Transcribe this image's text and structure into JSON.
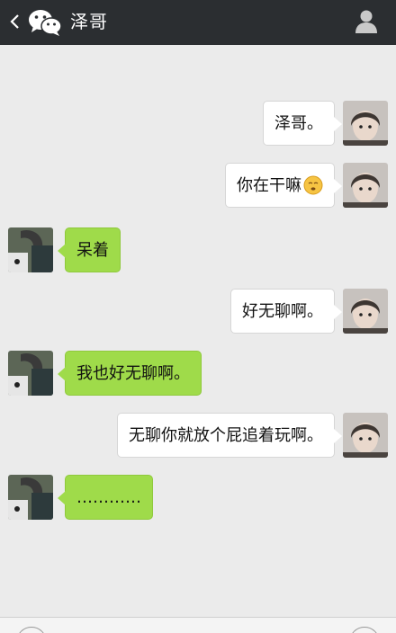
{
  "header": {
    "title": "泽哥",
    "back_icon": "back-chevron-icon",
    "app_icon": "wechat-icon",
    "profile_icon": "person-icon"
  },
  "messages": [
    {
      "side": "right",
      "text": "泽哥。"
    },
    {
      "side": "right",
      "text": "你在干嘛",
      "emoji": "sleepy-face-emoji"
    },
    {
      "side": "left",
      "text": "呆着"
    },
    {
      "side": "right",
      "text": "好无聊啊。"
    },
    {
      "side": "left",
      "text": "我也好无聊啊。"
    },
    {
      "side": "right",
      "text": "无聊你就放个屁追着玩啊。"
    },
    {
      "side": "left",
      "text": "…………"
    }
  ],
  "colors": {
    "header_bg": "#2b2e31",
    "chat_bg": "#ebebeb",
    "outgoing_bubble": "#ffffff",
    "incoming_bubble": "#9fdb4a"
  }
}
